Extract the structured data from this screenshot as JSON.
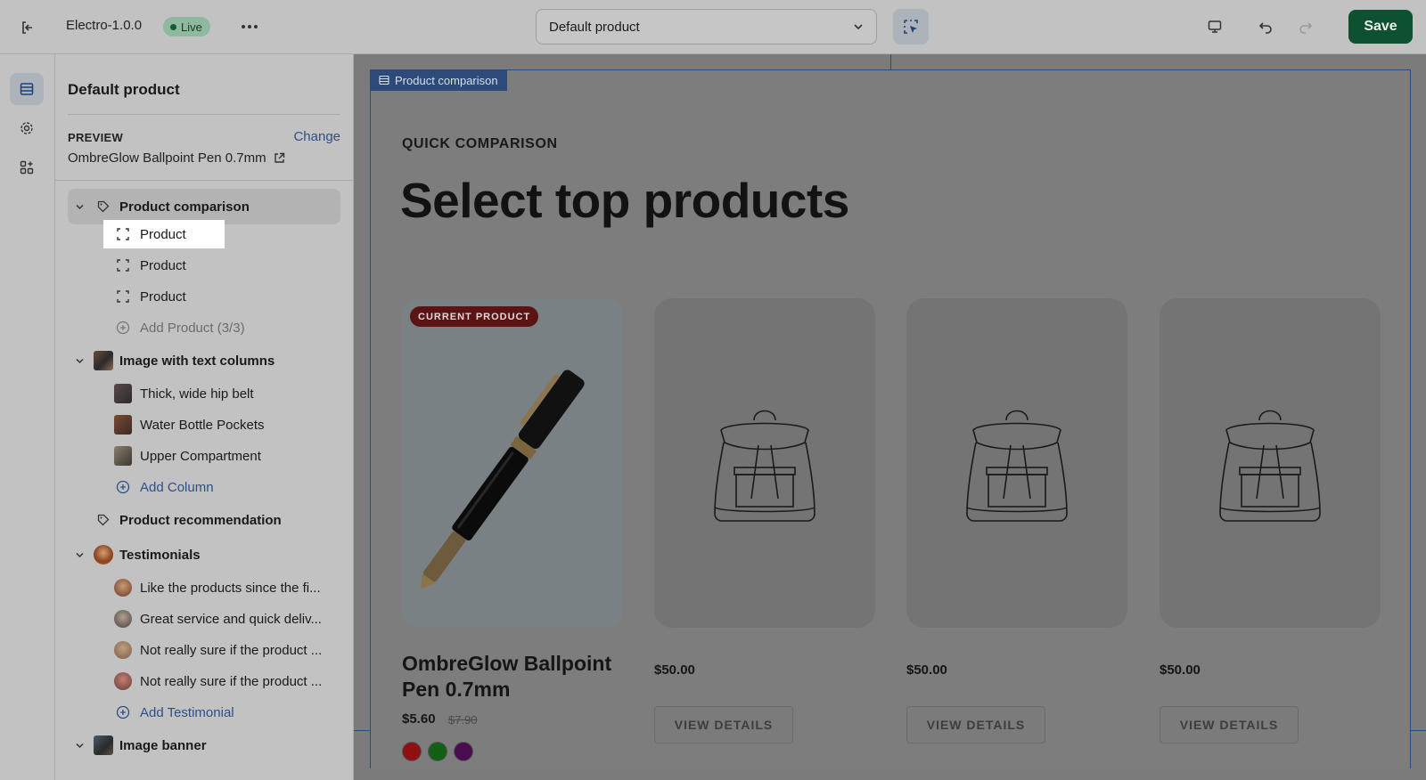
{
  "topbar": {
    "theme_name": "Electro-1.0.0",
    "status": "Live",
    "template_select_value": "Default product",
    "save_label": "Save"
  },
  "sidebar": {
    "title": "Default product",
    "preview_label": "PREVIEW",
    "change_label": "Change",
    "preview_product": "OmbreGlow Ballpoint Pen 0.7mm",
    "sections": {
      "product_comparison": {
        "label": "Product comparison",
        "blocks": [
          "Product",
          "Product",
          "Product"
        ],
        "add_label": "Add Product (3/3)"
      },
      "image_text_columns": {
        "label": "Image with text columns",
        "blocks": [
          "Thick, wide hip belt",
          "Water Bottle Pockets",
          "Upper Compartment"
        ],
        "add_label": "Add Column"
      },
      "product_recommendation": {
        "label": "Product recommendation"
      },
      "testimonials": {
        "label": "Testimonials",
        "blocks": [
          "Like the products since the fi...",
          "Great service and quick deliv...",
          "Not really sure if the product ...",
          "Not really sure if the product ..."
        ],
        "add_label": "Add Testimonial"
      },
      "image_banner": {
        "label": "Image banner"
      }
    }
  },
  "preview": {
    "section_tag": "Product comparison",
    "eyebrow": "QUICK COMPARISON",
    "headline": "Select top products",
    "current_badge": "CURRENT PRODUCT",
    "current_product": {
      "title": "OmbreGlow Ballpoint Pen 0.7mm",
      "price": "$5.60",
      "compare_price": "$7.90",
      "swatches": [
        "#8e1010",
        "#116016",
        "#4b0c4f"
      ]
    },
    "compared_products": [
      {
        "price": "$50.00",
        "button": "VIEW DETAILS"
      },
      {
        "price": "$50.00",
        "button": "VIEW DETAILS"
      },
      {
        "price": "$50.00",
        "button": "VIEW DETAILS"
      }
    ]
  }
}
